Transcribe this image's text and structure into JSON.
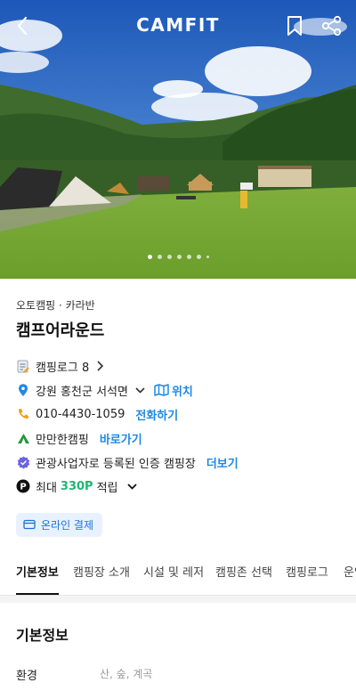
{
  "header": {
    "logo": "CAMFIT",
    "icons": {
      "back": "back-chevron-icon",
      "bookmark": "bookmark-icon",
      "share": "share-icon"
    }
  },
  "carousel": {
    "total_dots": 7,
    "active_index": 0
  },
  "camp": {
    "category": "오토캠핑 · 카라반",
    "name": "캠프어라운드"
  },
  "details": {
    "log": {
      "label": "캠핑로그 8"
    },
    "location": {
      "address": "강원 홍천군 서석면",
      "action": "위치"
    },
    "phone": {
      "number": "010-4430-1059",
      "action": "전화하기"
    },
    "partner": {
      "name": "만만한캠핑",
      "action": "바로가기"
    },
    "certified": {
      "text": "관광사업자로 등록된 인증 캠핑장",
      "action": "더보기"
    },
    "points": {
      "prefix": "최대",
      "amount": "330P",
      "suffix": "적립"
    }
  },
  "payment_badge": {
    "label": "온라인 결제"
  },
  "tabs": [
    {
      "label": "기본정보"
    },
    {
      "label": "캠핑장 소개"
    },
    {
      "label": "시설 및 레저"
    },
    {
      "label": "캠핑존 선택"
    },
    {
      "label": "캠핑로그"
    },
    {
      "label": "운영"
    }
  ],
  "basic_info": {
    "section_title": "기본정보",
    "environment_label": "환경",
    "environment_value": "산, 숲, 계곡"
  },
  "colors": {
    "link": "#1e88e5",
    "points": "#22b573",
    "badge_bg": "#e8f2ff"
  }
}
